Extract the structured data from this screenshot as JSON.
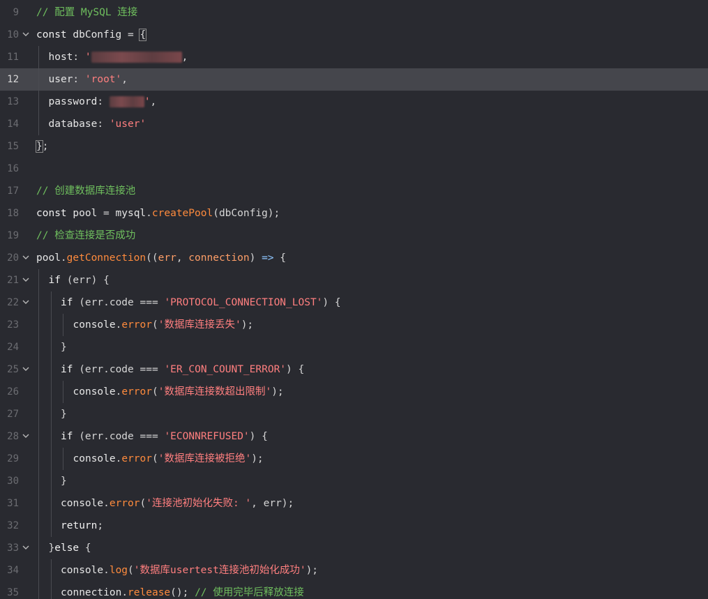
{
  "editor": {
    "active_line": 12,
    "lines": [
      {
        "n": "9",
        "fold": false,
        "indent": 0,
        "tokens": [
          {
            "t": "// 配置 MySQL 连接",
            "c": "cmt"
          }
        ]
      },
      {
        "n": "10",
        "fold": true,
        "indent": 0,
        "tokens": [
          {
            "t": "const",
            "c": "kw"
          },
          {
            "t": " dbConfig ",
            "c": "var"
          },
          {
            "t": "=",
            "c": "pun"
          },
          {
            "t": " ",
            "c": "var"
          },
          {
            "t": "{",
            "c": "pun",
            "hl": true
          }
        ]
      },
      {
        "n": "11",
        "fold": false,
        "indent": 1,
        "tokens": [
          {
            "t": "host",
            "c": "var"
          },
          {
            "t": ": ",
            "c": "pun"
          },
          {
            "t": "'",
            "c": "str"
          },
          {
            "redact": 130
          },
          {
            "t": ",",
            "c": "pun"
          }
        ]
      },
      {
        "n": "12",
        "fold": false,
        "indent": 1,
        "tokens": [
          {
            "t": "user",
            "c": "var"
          },
          {
            "t": ": ",
            "c": "pun"
          },
          {
            "t": "'root'",
            "c": "str"
          },
          {
            "t": ",",
            "c": "pun"
          }
        ]
      },
      {
        "n": "13",
        "fold": false,
        "indent": 1,
        "tokens": [
          {
            "t": "password",
            "c": "var"
          },
          {
            "t": ": ",
            "c": "pun"
          },
          {
            "redact": 50
          },
          {
            "t": "'",
            "c": "str"
          },
          {
            "t": ",",
            "c": "pun"
          }
        ]
      },
      {
        "n": "14",
        "fold": false,
        "indent": 1,
        "tokens": [
          {
            "t": "database",
            "c": "var"
          },
          {
            "t": ": ",
            "c": "pun"
          },
          {
            "t": "'user'",
            "c": "str"
          }
        ]
      },
      {
        "n": "15",
        "fold": false,
        "indent": 0,
        "tokens": [
          {
            "t": "}",
            "c": "pun",
            "hl": true
          },
          {
            "t": ";",
            "c": "pun"
          }
        ]
      },
      {
        "n": "16",
        "fold": false,
        "indent": 0,
        "tokens": []
      },
      {
        "n": "17",
        "fold": false,
        "indent": 0,
        "tokens": [
          {
            "t": "// 创建数据库连接池",
            "c": "cmt"
          }
        ]
      },
      {
        "n": "18",
        "fold": false,
        "indent": 0,
        "tokens": [
          {
            "t": "const",
            "c": "kw"
          },
          {
            "t": " pool ",
            "c": "var"
          },
          {
            "t": "=",
            "c": "pun"
          },
          {
            "t": " mysql",
            "c": "var"
          },
          {
            "t": ".",
            "c": "pun"
          },
          {
            "t": "createPool",
            "c": "fn"
          },
          {
            "t": "(dbConfig);",
            "c": "pun"
          }
        ]
      },
      {
        "n": "19",
        "fold": false,
        "indent": 0,
        "tokens": [
          {
            "t": "// 检查连接是否成功",
            "c": "cmt"
          }
        ]
      },
      {
        "n": "20",
        "fold": true,
        "indent": 0,
        "tokens": [
          {
            "t": "pool",
            "c": "var"
          },
          {
            "t": ".",
            "c": "pun"
          },
          {
            "t": "getConnection",
            "c": "fn"
          },
          {
            "t": "((",
            "c": "pun"
          },
          {
            "t": "err",
            "c": "par"
          },
          {
            "t": ", ",
            "c": "pun"
          },
          {
            "t": "connection",
            "c": "par"
          },
          {
            "t": ") ",
            "c": "pun"
          },
          {
            "t": "=>",
            "c": "op"
          },
          {
            "t": " {",
            "c": "pun"
          }
        ]
      },
      {
        "n": "21",
        "fold": true,
        "indent": 1,
        "tokens": [
          {
            "t": "if",
            "c": "kw"
          },
          {
            "t": " (err) {",
            "c": "pun"
          }
        ]
      },
      {
        "n": "22",
        "fold": true,
        "indent": 2,
        "tokens": [
          {
            "t": "if",
            "c": "kw"
          },
          {
            "t": " (err.code ",
            "c": "pun"
          },
          {
            "t": "===",
            "c": "pun"
          },
          {
            "t": " ",
            "c": "pun"
          },
          {
            "t": "'PROTOCOL_CONNECTION_LOST'",
            "c": "str"
          },
          {
            "t": ") {",
            "c": "pun"
          }
        ]
      },
      {
        "n": "23",
        "fold": false,
        "indent": 3,
        "tokens": [
          {
            "t": "console",
            "c": "var"
          },
          {
            "t": ".",
            "c": "pun"
          },
          {
            "t": "error",
            "c": "fn"
          },
          {
            "t": "(",
            "c": "pun"
          },
          {
            "t": "'数据库连接丢失'",
            "c": "str"
          },
          {
            "t": ");",
            "c": "pun"
          }
        ]
      },
      {
        "n": "24",
        "fold": false,
        "indent": 2,
        "tokens": [
          {
            "t": "}",
            "c": "pun"
          }
        ]
      },
      {
        "n": "25",
        "fold": true,
        "indent": 2,
        "tokens": [
          {
            "t": "if",
            "c": "kw"
          },
          {
            "t": " (err.code ",
            "c": "pun"
          },
          {
            "t": "===",
            "c": "pun"
          },
          {
            "t": " ",
            "c": "pun"
          },
          {
            "t": "'ER_CON_COUNT_ERROR'",
            "c": "str"
          },
          {
            "t": ") {",
            "c": "pun"
          }
        ]
      },
      {
        "n": "26",
        "fold": false,
        "indent": 3,
        "tokens": [
          {
            "t": "console",
            "c": "var"
          },
          {
            "t": ".",
            "c": "pun"
          },
          {
            "t": "error",
            "c": "fn"
          },
          {
            "t": "(",
            "c": "pun"
          },
          {
            "t": "'数据库连接数超出限制'",
            "c": "str"
          },
          {
            "t": ");",
            "c": "pun"
          }
        ]
      },
      {
        "n": "27",
        "fold": false,
        "indent": 2,
        "tokens": [
          {
            "t": "}",
            "c": "pun"
          }
        ]
      },
      {
        "n": "28",
        "fold": true,
        "indent": 2,
        "tokens": [
          {
            "t": "if",
            "c": "kw"
          },
          {
            "t": " (err.code ",
            "c": "pun"
          },
          {
            "t": "===",
            "c": "pun"
          },
          {
            "t": " ",
            "c": "pun"
          },
          {
            "t": "'ECONNREFUSED'",
            "c": "str"
          },
          {
            "t": ") {",
            "c": "pun"
          }
        ]
      },
      {
        "n": "29",
        "fold": false,
        "indent": 3,
        "tokens": [
          {
            "t": "console",
            "c": "var"
          },
          {
            "t": ".",
            "c": "pun"
          },
          {
            "t": "error",
            "c": "fn"
          },
          {
            "t": "(",
            "c": "pun"
          },
          {
            "t": "'数据库连接被拒绝'",
            "c": "str"
          },
          {
            "t": ");",
            "c": "pun"
          }
        ]
      },
      {
        "n": "30",
        "fold": false,
        "indent": 2,
        "tokens": [
          {
            "t": "}",
            "c": "pun"
          }
        ]
      },
      {
        "n": "31",
        "fold": false,
        "indent": 2,
        "tokens": [
          {
            "t": "console",
            "c": "var"
          },
          {
            "t": ".",
            "c": "pun"
          },
          {
            "t": "error",
            "c": "fn"
          },
          {
            "t": "(",
            "c": "pun"
          },
          {
            "t": "'连接池初始化失败: '",
            "c": "str"
          },
          {
            "t": ", err);",
            "c": "pun"
          }
        ]
      },
      {
        "n": "32",
        "fold": false,
        "indent": 2,
        "tokens": [
          {
            "t": "return",
            "c": "kw"
          },
          {
            "t": ";",
            "c": "pun"
          }
        ]
      },
      {
        "n": "33",
        "fold": true,
        "indent": 1,
        "tokens": [
          {
            "t": "}",
            "c": "pun"
          },
          {
            "t": "else",
            "c": "kw"
          },
          {
            "t": " {",
            "c": "pun"
          }
        ]
      },
      {
        "n": "34",
        "fold": false,
        "indent": 2,
        "tokens": [
          {
            "t": "console",
            "c": "var"
          },
          {
            "t": ".",
            "c": "pun"
          },
          {
            "t": "log",
            "c": "fn"
          },
          {
            "t": "(",
            "c": "pun"
          },
          {
            "t": "'数据库usertest连接池初始化成功'",
            "c": "str"
          },
          {
            "t": ");",
            "c": "pun"
          }
        ]
      },
      {
        "n": "35",
        "fold": false,
        "indent": 2,
        "tokens": [
          {
            "t": "connection",
            "c": "var"
          },
          {
            "t": ".",
            "c": "pun"
          },
          {
            "t": "release",
            "c": "fn"
          },
          {
            "t": "(); ",
            "c": "pun"
          },
          {
            "t": "// 使用完毕后释放连接",
            "c": "cmt"
          }
        ]
      }
    ]
  }
}
